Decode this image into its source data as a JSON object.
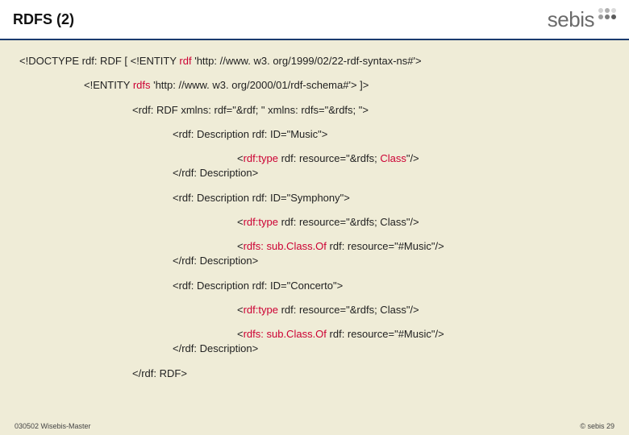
{
  "header": {
    "title": "RDFS (2)",
    "logo_text": "sebis"
  },
  "lines": {
    "l1a": "<!DOCTYPE rdf: RDF [ <!ENTITY ",
    "l1b": "rdf",
    "l1c": " 'http: //www. w3. org/1999/02/22-rdf-syntax-ns#'>",
    "l2a": "<!ENTITY ",
    "l2b": "rdfs",
    "l2c": " 'http: //www. w3. org/2000/01/rdf-schema#'> ]>",
    "l3": "<rdf: RDF xmlns: rdf=\"&rdf; \" xmlns: rdfs=\"&rdfs; \">",
    "l4": "<rdf: Description rdf: ID=\"Music\">",
    "l5a": "<",
    "l5b": "rdf:type",
    "l5c": " rdf: resource=\"&rdfs; ",
    "l5d": "Class",
    "l5e": "\"/>",
    "l6": "</rdf: Description>",
    "l7": "<rdf: Description rdf: ID=\"Symphony\">",
    "l8a": "<",
    "l8b": "rdf:type",
    "l8c": " rdf: resource=\"&rdfs; Class\"/>",
    "l9a": "<",
    "l9b": "rdfs: sub.Class.Of",
    "l9c": " rdf: resource=\"#Music\"/>",
    "l10": "</rdf: Description>",
    "l11": "<rdf: Description rdf: ID=\"Concerto\">",
    "l12a": "<",
    "l12b": "rdf:type",
    "l12c": " rdf: resource=\"&rdfs; Class\"/>",
    "l13a": "<",
    "l13b": "rdfs: sub.Class.Of",
    "l13c": " rdf: resource=\"#Music\"/>",
    "l14": "</rdf: Description>",
    "l15": "</rdf: RDF>"
  },
  "footer": {
    "left": "030502 Wisebis-Master",
    "right": "© sebis 29"
  }
}
